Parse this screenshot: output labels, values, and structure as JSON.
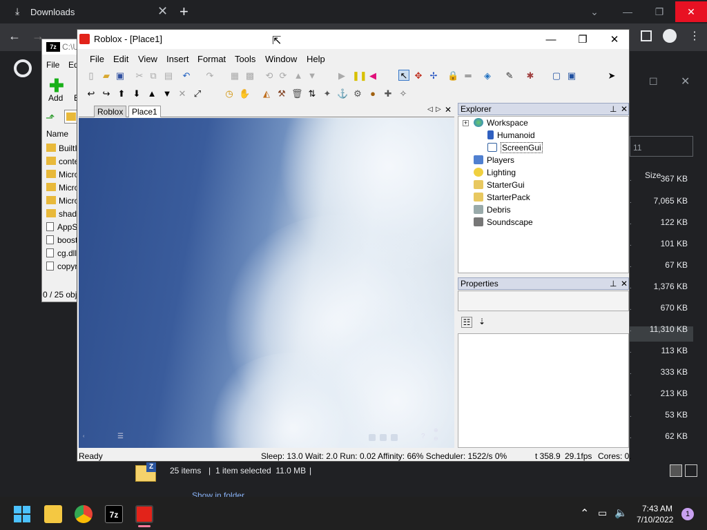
{
  "chrome": {
    "tab_title": "Downloads",
    "close_glyph": "✕",
    "new_tab_glyph": "+"
  },
  "downloads_panel": {
    "path_fragment": "11",
    "size_header": "Size",
    "sizes": [
      "367 KB",
      "7,065 KB",
      "122 KB",
      "101 KB",
      "67 KB",
      "1,376 KB",
      "670 KB",
      "11,310 KB",
      "113 KB",
      "333 KB",
      "213 KB",
      "53 KB",
      "62 KB"
    ],
    "status": {
      "items": "25 items",
      "selected": "1 item selected  11.0 MB"
    },
    "show_in_folder": "Show in folder"
  },
  "sevenzip": {
    "title": "C:\\U",
    "menu_file": "File",
    "menu_edit": "Ed",
    "add_label": "Add",
    "extract_label": "E",
    "name_header": "Name",
    "folders": [
      "BuiltI",
      "conte",
      "Micro",
      "Micro",
      "Micro",
      "shade"
    ],
    "files": [
      "AppS",
      "boost",
      "cg.dll",
      "copyr"
    ],
    "status": "0 / 25 obj"
  },
  "roblox": {
    "title": "Roblox - [Place1]",
    "menu": [
      "File",
      "Edit",
      "View",
      "Insert",
      "Format",
      "Tools",
      "Window",
      "Help"
    ],
    "tabs": [
      "Roblox",
      "Place1"
    ],
    "explorer": {
      "title": "Explorer",
      "items": [
        "Workspace",
        "Humanoid",
        "ScreenGui",
        "Players",
        "Lighting",
        "StarterGui",
        "StarterPack",
        "Debris",
        "Soundscape"
      ]
    },
    "properties": {
      "title": "Properties"
    },
    "status": {
      "ready": "Ready",
      "perf": "Sleep: 13.0 Wait: 2.0 Run: 0.02 Affinity: 66% Scheduler: 1522/s 0%",
      "time": "t 358.9",
      "fps": "29.1fps",
      "cores": "Cores: 0."
    }
  },
  "taskbar": {
    "time": "7:43 AM",
    "date": "7/10/2022",
    "notification_count": "1"
  }
}
